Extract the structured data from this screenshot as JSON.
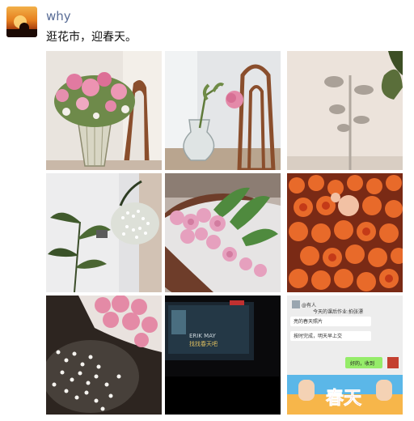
{
  "post": {
    "username": "why",
    "text": "逛花市，迎春天。"
  },
  "photos": [
    {
      "icon": "pink-carnations-in-vase-photo"
    },
    {
      "icon": "single-rose-glass-vase-photo"
    },
    {
      "icon": "plant-shadow-on-wall-photo"
    },
    {
      "icon": "babys-breath-and-plant-photo"
    },
    {
      "icon": "pink-bouquet-on-table-photo"
    },
    {
      "icon": "orange-roses-market-stall-photo"
    },
    {
      "icon": "babys-breath-pink-flowers-photo"
    },
    {
      "icon": "dark-karaoke-screen-photo"
    },
    {
      "icon": "chat-screenshot-photo"
    }
  ],
  "chat_screenshot": {
    "line1": "@有人",
    "line2": "今天的课后作业:拍张漂",
    "line3": "亮的春天照片",
    "line4": "按时完成，明天早上交",
    "reply": "好的，收到",
    "banner": "春天"
  },
  "karaoke_screen": {
    "line1": "ERIK MAY",
    "line2": "找找春天吧"
  }
}
